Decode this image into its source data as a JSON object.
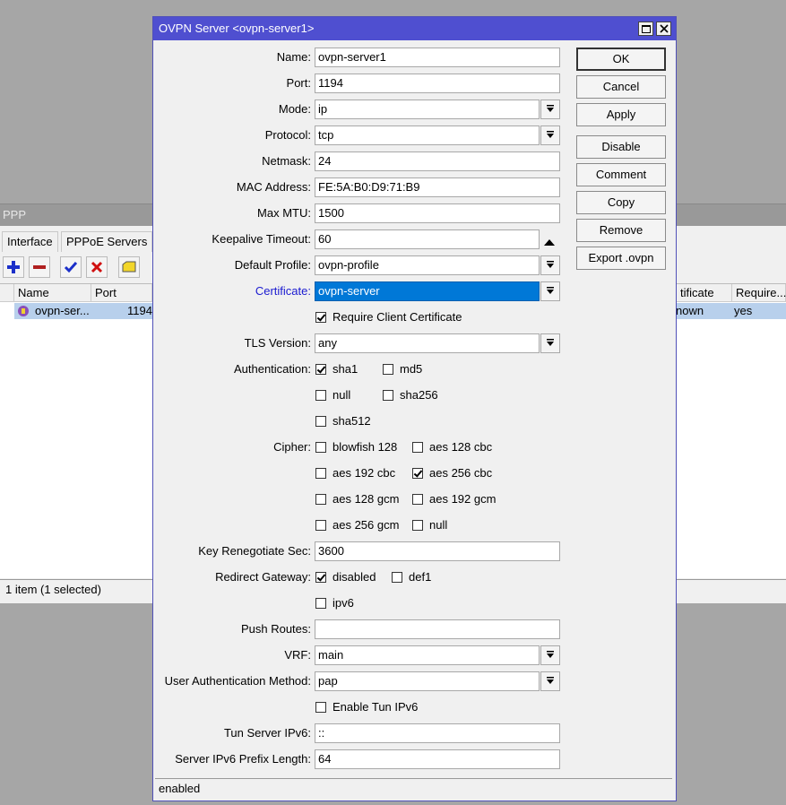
{
  "ppp": {
    "title": "PPP",
    "tabs": [
      "Interface",
      "PPPoE Servers"
    ],
    "columns": [
      "Name",
      "Port",
      "tificate",
      "Require..."
    ],
    "row": {
      "name": "ovpn-ser...",
      "port": "1194",
      "certificate": "nown",
      "require": "yes"
    },
    "status": "1 item (1 selected)"
  },
  "dialog": {
    "title": "OVPN Server <ovpn-server1>",
    "fields": {
      "name": {
        "label": "Name:",
        "value": "ovpn-server1"
      },
      "port": {
        "label": "Port:",
        "value": "1194"
      },
      "mode": {
        "label": "Mode:",
        "value": "ip"
      },
      "protocol": {
        "label": "Protocol:",
        "value": "tcp"
      },
      "netmask": {
        "label": "Netmask:",
        "value": "24"
      },
      "mac": {
        "label": "MAC Address:",
        "value": "FE:5A:B0:D9:71:B9"
      },
      "mtu": {
        "label": "Max MTU:",
        "value": "1500"
      },
      "keepalive": {
        "label": "Keepalive Timeout:",
        "value": "60"
      },
      "profile": {
        "label": "Default Profile:",
        "value": "ovpn-profile"
      },
      "certificate": {
        "label": "Certificate:",
        "value": "ovpn-server"
      },
      "require_client_cert": "Require Client Certificate",
      "tls": {
        "label": "TLS Version:",
        "value": "any"
      },
      "auth_label": "Authentication:",
      "auth": [
        "sha1",
        "md5",
        "null",
        "sha256",
        "sha512"
      ],
      "cipher_label": "Cipher:",
      "cipher": [
        "blowfish 128",
        "aes 128 cbc",
        "aes 192 cbc",
        "aes 256 cbc",
        "aes 128 gcm",
        "aes 192 gcm",
        "aes 256 gcm",
        "null"
      ],
      "renegotiate": {
        "label": "Key Renegotiate Sec:",
        "value": "3600"
      },
      "redirect_label": "Redirect Gateway:",
      "redirect": [
        "disabled",
        "def1",
        "ipv6"
      ],
      "push_routes": {
        "label": "Push Routes:",
        "value": ""
      },
      "vrf": {
        "label": "VRF:",
        "value": "main"
      },
      "user_auth": {
        "label": "User Authentication Method:",
        "value": "pap"
      },
      "enable_tun_ipv6": "Enable Tun IPv6",
      "tun_ipv6": {
        "label": "Tun Server IPv6:",
        "value": "::"
      },
      "prefix_len": {
        "label": "Server IPv6 Prefix Length:",
        "value": "64"
      }
    },
    "buttons": [
      "OK",
      "Cancel",
      "Apply",
      "Disable",
      "Comment",
      "Copy",
      "Remove",
      "Export .ovpn"
    ],
    "status": "enabled"
  },
  "colors": {
    "title_bar": "#4f4fd0",
    "selection": "#0078d7",
    "link_label": "#1a1ad0"
  }
}
